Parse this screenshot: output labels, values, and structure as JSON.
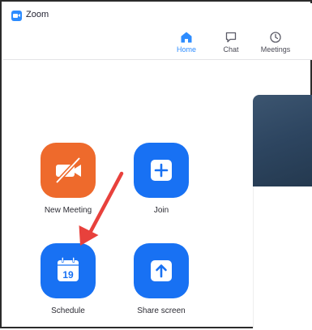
{
  "window": {
    "title": "Zoom"
  },
  "nav": {
    "tabs": [
      {
        "label": "Home",
        "icon": "home-icon",
        "active": true
      },
      {
        "label": "Chat",
        "icon": "chat-icon",
        "active": false
      },
      {
        "label": "Meetings",
        "icon": "clock-icon",
        "active": false
      }
    ]
  },
  "actions": [
    {
      "label": "New Meeting",
      "icon": "video-off-icon",
      "color": "#ee6a2c"
    },
    {
      "label": "Join",
      "icon": "plus-icon",
      "color": "#1871f3"
    },
    {
      "label": "Schedule",
      "icon": "calendar-icon",
      "color": "#1871f3",
      "calendar_day": "19"
    },
    {
      "label": "Share screen",
      "icon": "share-up-arrow-icon",
      "color": "#1871f3"
    }
  ],
  "colors": {
    "accent": "#2d8cff",
    "annotation_arrow": "#e8413c",
    "side_panel": "#2d4560"
  }
}
